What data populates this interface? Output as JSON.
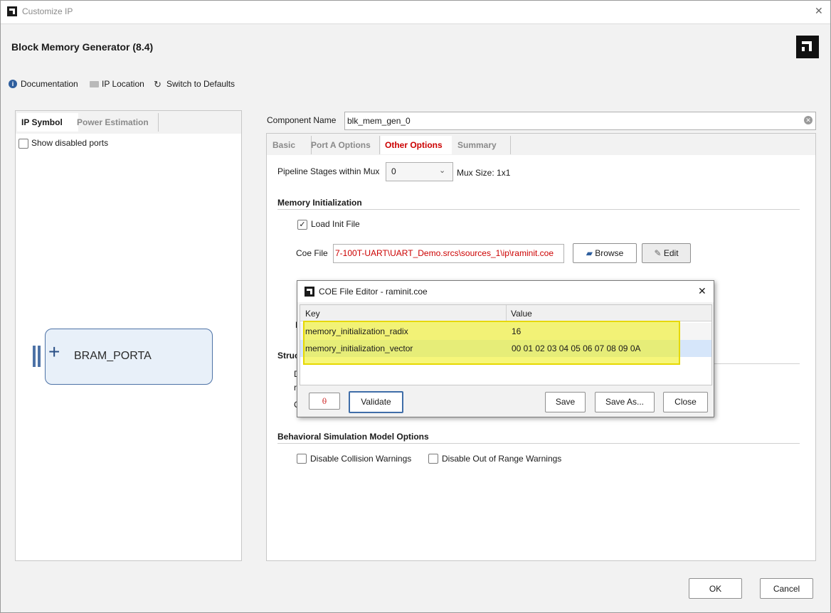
{
  "window": {
    "title": "Customize IP",
    "close_glyph": "✕"
  },
  "header": {
    "ip_name": "Block Memory Generator (8.4)",
    "toolbar": {
      "documentation": "Documentation",
      "ip_location": "IP Location",
      "switch_defaults": "Switch to Defaults"
    }
  },
  "left": {
    "tabs": [
      "IP Symbol",
      "Power Estimation"
    ],
    "show_disabled_ports": "Show disabled ports",
    "symbol": {
      "plus": "+",
      "port_name": "BRAM_PORTA"
    }
  },
  "right": {
    "component_label": "Component Name",
    "component_value": "blk_mem_gen_0",
    "tabs": [
      "Basic",
      "Port A Options",
      "Other Options",
      "Summary"
    ],
    "pipeline_label": "Pipeline Stages within Mux",
    "pipeline_value": "0",
    "mux_size": "Mux Size: 1x1",
    "mem_init_heading": "Memory Initialization",
    "load_init_label": "Load Init File",
    "coe_label": "Coe File",
    "coe_value": "7-100T-UART\\UART_Demo.srcs\\sources_1\\ip\\raminit.coe",
    "browse": "Browse",
    "edit": "Edit",
    "partial_r": "R",
    "partial_struct": "Struc",
    "partial_d": "D",
    "partial_rr": "r",
    "partial_c": "C",
    "behavioral_heading": "Behavioral Simulation Model Options",
    "disable_collision": "Disable Collision Warnings",
    "disable_range": "Disable Out of Range Warnings"
  },
  "dialog": {
    "title": "COE File Editor - raminit.coe",
    "columns": [
      "Key",
      "Value"
    ],
    "rows": [
      {
        "key": "memory_initialization_radix",
        "value": "16"
      },
      {
        "key": "memory_initialization_vector",
        "value": "00 01 02 03 04 05 06 07 08 09 0A"
      }
    ],
    "validate": "Validate",
    "save": "Save",
    "save_as": "Save As...",
    "close": "Close",
    "close_glyph": "✕"
  },
  "footer": {
    "ok": "OK",
    "cancel": "Cancel"
  },
  "colors": {
    "highlight": "#f5f542",
    "selected_row": "#d6e6fa",
    "active_tab": "#cc0000",
    "symbol_fill": "#e8f0f9",
    "symbol_border": "#4d72a6"
  }
}
